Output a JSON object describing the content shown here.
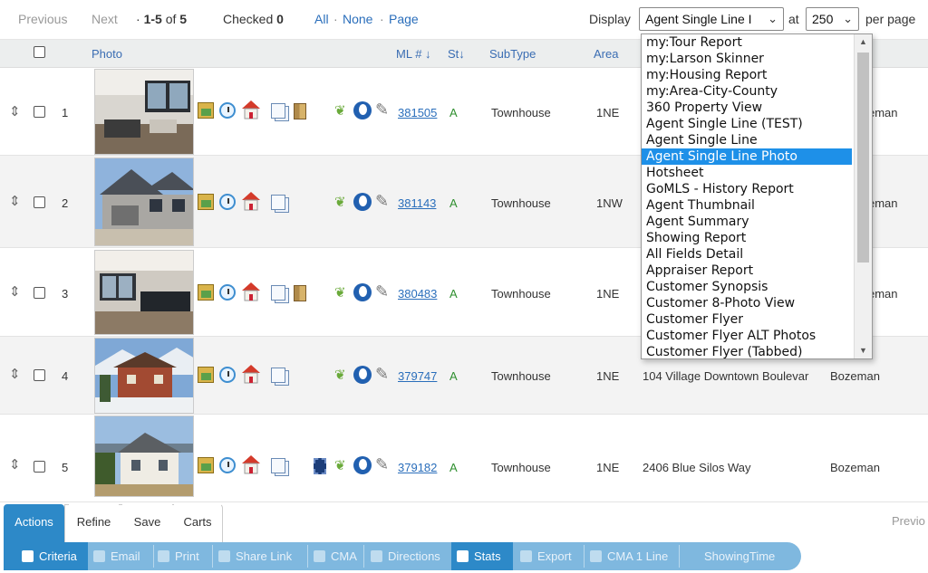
{
  "pager": {
    "previous": "Previous",
    "next": "Next",
    "range_prefix": "·",
    "range": "1-5",
    "of": "of",
    "total": "5",
    "checked_label": "Checked",
    "checked_count": "0",
    "all": "All",
    "none": "None",
    "page": "Page",
    "dot": "·",
    "display_label": "Display",
    "display_value": "Agent Single Line I",
    "at_label": "at",
    "per_page_value": "250",
    "per_page_label": "per page"
  },
  "columns": {
    "photo": "Photo",
    "mls": "ML #",
    "status": "St",
    "subtype": "SubType",
    "area": "Area"
  },
  "rows": [
    {
      "num": "1",
      "mls": "381505",
      "status": "A",
      "subtype": "Townhouse",
      "area": "1NE",
      "address": "",
      "city": "eman"
    },
    {
      "num": "2",
      "mls": "381143",
      "status": "A",
      "subtype": "Townhouse",
      "area": "1NW",
      "address": "",
      "city": "eman"
    },
    {
      "num": "3",
      "mls": "380483",
      "status": "A",
      "subtype": "Townhouse",
      "area": "1NE",
      "address": "",
      "city": "eman"
    },
    {
      "num": "4",
      "mls": "379747",
      "status": "A",
      "subtype": "Townhouse",
      "area": "1NE",
      "address": "104 Village Downtown Boulevar",
      "city": "Bozeman"
    },
    {
      "num": "5",
      "mls": "379182",
      "status": "A",
      "subtype": "Townhouse",
      "area": "1NE",
      "address": "2406 Blue Silos Way",
      "city": "Bozeman"
    }
  ],
  "dropdown": {
    "options": [
      "my:Tour Report",
      "my:Larson Skinner",
      "my:Housing Report",
      "my:Area-City-County",
      "360 Property View",
      "Agent Single Line (TEST)",
      "Agent Single Line",
      "Agent Single Line Photo",
      "Hotsheet",
      "GoMLS - History Report",
      "Agent Thumbnail",
      "Agent Summary",
      "Showing Report",
      "All Fields Detail",
      "Appraiser Report",
      "Customer Synopsis",
      "Customer 8-Photo View",
      "Customer Flyer",
      "Customer Flyer ALT Photos",
      "Customer Flyer (Tabbed)"
    ],
    "selected": "Agent Single Line Photo"
  },
  "tabs": [
    "Actions",
    "Refine",
    "Save",
    "Carts"
  ],
  "previo": "Previo",
  "toolbar": [
    "Criteria",
    "Email",
    "Print",
    "Share Link",
    "CMA",
    "Directions",
    "Stats",
    "Export",
    "CMA 1 Line",
    "ShowingTime"
  ],
  "colors": {
    "accent": "#2d89c8",
    "link": "#2a6ebb",
    "selected_option": "#1e90e8",
    "toolbar": "#7fb8df"
  }
}
